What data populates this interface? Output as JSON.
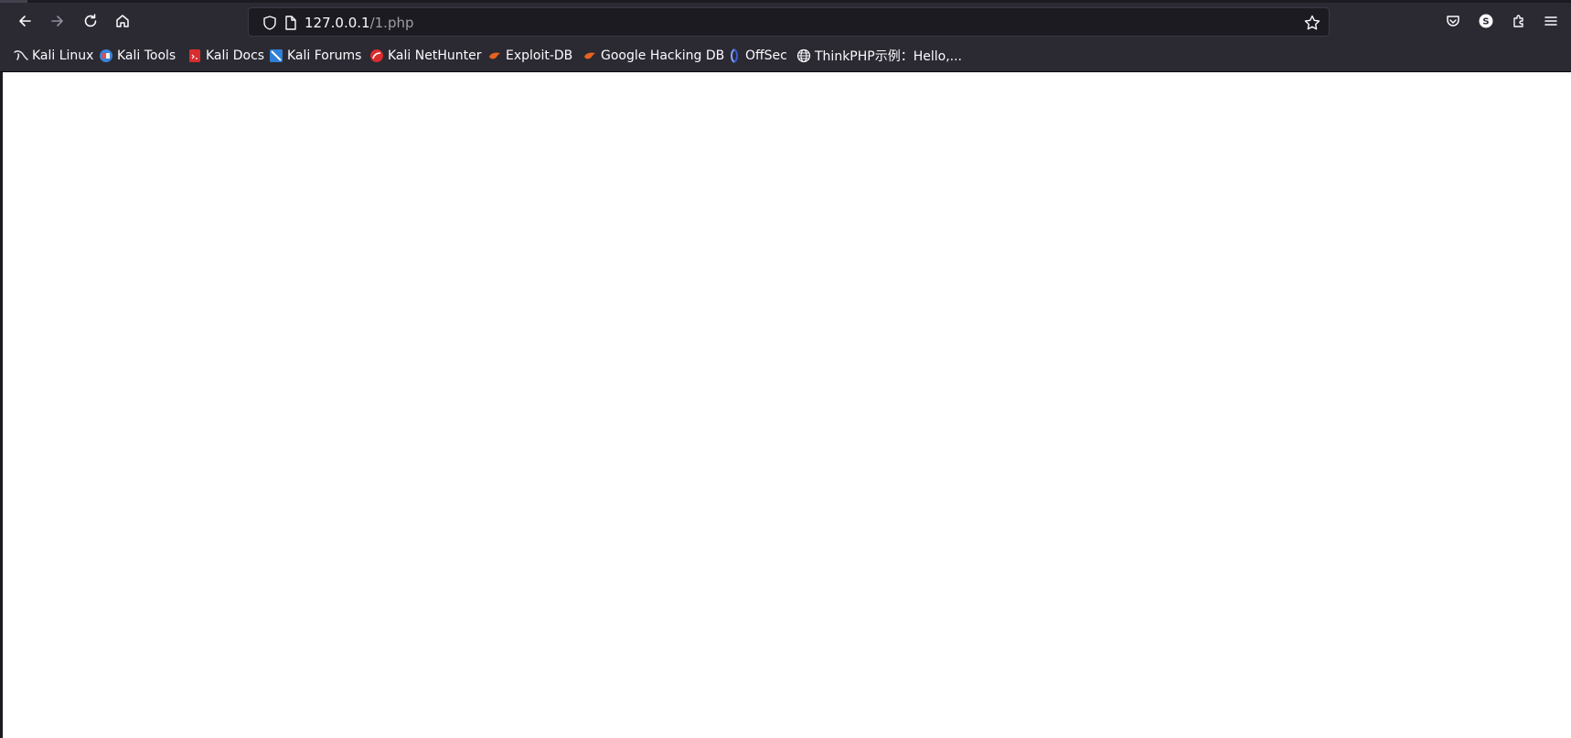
{
  "browser": {
    "url_host": "127.0.0.1",
    "url_path": "/1.php",
    "extension_badge": "S",
    "colors": {
      "toolbar": "#2b2a33",
      "urlbar": "#1c1b22",
      "text": "#fbfbfe",
      "path_text": "#9e9ea6",
      "content": "#ffffff"
    }
  },
  "nav": {
    "icons": [
      "back-arrow-icon",
      "forward-arrow-icon",
      "reload-icon",
      "home-icon"
    ]
  },
  "urlbar_icons": [
    "shield-icon",
    "page-icon",
    "star-icon"
  ],
  "toolbar_right_icons": [
    "pocket-icon",
    "extension-badge-icon",
    "extensions-puzzle-icon",
    "hamburger-menu-icon"
  ],
  "bookmarks": [
    {
      "label": "Kali Linux",
      "icon": "kali-dragon-icon"
    },
    {
      "label": "Kali Tools",
      "icon": "kali-tools-icon"
    },
    {
      "label": "Kali Docs",
      "icon": "kali-docs-icon"
    },
    {
      "label": "Kali Forums",
      "icon": "kali-forums-icon"
    },
    {
      "label": "Kali NetHunter",
      "icon": "kali-nethunter-icon"
    },
    {
      "label": "Exploit-DB",
      "icon": "exploit-db-icon"
    },
    {
      "label": "Google Hacking DB",
      "icon": "ghdb-icon"
    },
    {
      "label": "OffSec",
      "icon": "offsec-icon"
    },
    {
      "label": "ThinkPHP示例：Hello,...",
      "icon": "globe-icon"
    }
  ]
}
